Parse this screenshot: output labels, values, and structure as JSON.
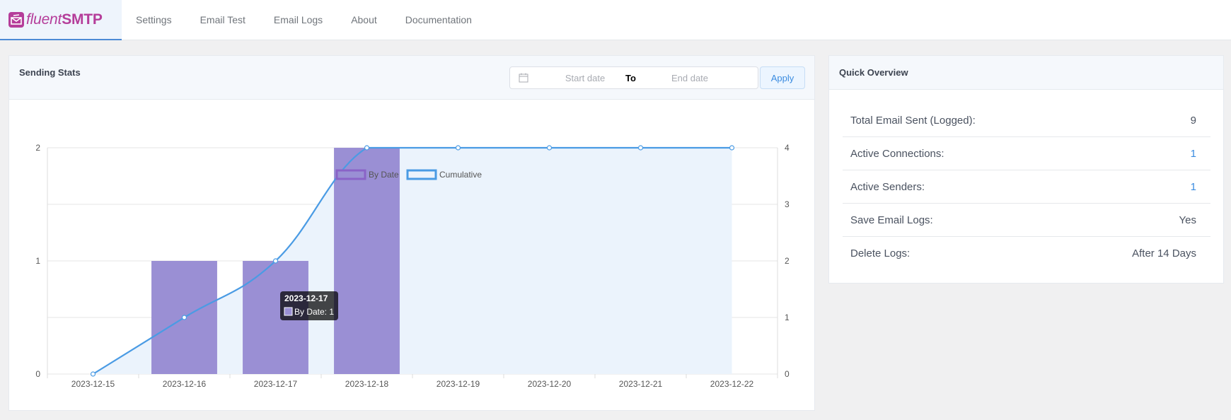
{
  "brand": {
    "name_italic": "fluent",
    "name_bold": "SMTP"
  },
  "nav": {
    "items": [
      "Settings",
      "Email Test",
      "Email Logs",
      "About",
      "Documentation"
    ]
  },
  "stats": {
    "title": "Sending Stats",
    "start_placeholder": "Start date",
    "separator": "To",
    "end_placeholder": "End date",
    "apply_label": "Apply"
  },
  "overview": {
    "title": "Quick Overview",
    "rows": [
      {
        "label": "Total Email Sent (Logged):",
        "value": "9"
      },
      {
        "label": "Active Connections:",
        "value": "1"
      },
      {
        "label": "Active Senders:",
        "value": "1"
      },
      {
        "label": "Save Email Logs:",
        "value": "Yes"
      },
      {
        "label": "Delete Logs:",
        "value": "After 14 Days"
      }
    ]
  },
  "chart_data": {
    "type": "bar",
    "categories": [
      "2023-12-15",
      "2023-12-16",
      "2023-12-17",
      "2023-12-18",
      "2023-12-19",
      "2023-12-20",
      "2023-12-21",
      "2023-12-22"
    ],
    "series": [
      {
        "name": "By Date",
        "type": "bar",
        "axis": "left",
        "color": "#9a8fd4",
        "values": [
          0,
          1,
          1,
          2,
          0,
          0,
          0,
          0
        ]
      },
      {
        "name": "Cumulative",
        "type": "area",
        "axis": "right",
        "color": "#4a9be4",
        "fill": "#ebf3fc",
        "values": [
          0,
          1,
          2,
          4,
          4,
          4,
          4,
          4
        ]
      }
    ],
    "y_left": {
      "ylim": [
        0,
        2
      ],
      "ticks": [
        "0",
        "1",
        "2"
      ]
    },
    "y_right": {
      "ylim": [
        0,
        4
      ],
      "ticks": [
        "0",
        "1",
        "2",
        "3",
        "4"
      ]
    },
    "legend": "top-center",
    "grid": true,
    "tooltip": {
      "title": "2023-12-17",
      "text": "By Date: 1"
    }
  }
}
